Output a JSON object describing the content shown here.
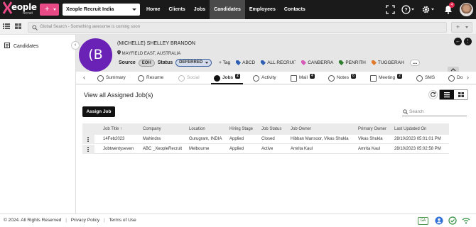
{
  "brand": {
    "name": "eople",
    "sub": "recruit",
    "accent": "#e84a86"
  },
  "topbar": {
    "plus_label": "+",
    "company": "Xeople Recruit India",
    "nav": [
      "Home",
      "Clients",
      "Jobs",
      "Candidates",
      "Employees",
      "Contacts"
    ],
    "active_nav": "Candidates",
    "notification_count": "4",
    "icons": [
      "expand-icon",
      "help-icon",
      "settings-icon",
      "bell-icon",
      "avatar"
    ]
  },
  "subbar": {
    "search_placeholder": "Global Search - Something awesome is coming soon",
    "plus_label": "+"
  },
  "sidebar": {
    "items": [
      {
        "label": "Candidates",
        "icon": "candidate-card-icon"
      }
    ]
  },
  "profile": {
    "avatar_initial": "(B",
    "name": "(MICHELLE) SHELLEY BRANDON",
    "location": "MAYFIELD EAST, AUSTRALIA",
    "source_label": "Source",
    "source_value": "EOH",
    "status_label": "Status",
    "status_value": "DEFERRED",
    "add_tag_label": "+ Tag",
    "tags": [
      "ABCD",
      "ALL RECRUITA",
      "CANBERRA",
      "PENRITH",
      "TUGGERAH"
    ],
    "more_label": "..."
  },
  "tabs": {
    "items": [
      {
        "label": "Summary",
        "badge": ""
      },
      {
        "label": "Resume",
        "badge": ""
      },
      {
        "label": "Social",
        "badge": ""
      },
      {
        "label": "Jobs",
        "badge": "2"
      },
      {
        "label": "Activity",
        "badge": ""
      },
      {
        "label": "Mail",
        "badge": "4"
      },
      {
        "label": "Notes",
        "badge": "6"
      },
      {
        "label": "Meeting",
        "badge": "2"
      },
      {
        "label": "SMS",
        "badge": ""
      },
      {
        "label": "Do",
        "badge": ""
      }
    ],
    "active": "Jobs",
    "disabled": "Social"
  },
  "jobs": {
    "title": "View all Assigned Job(s)",
    "assign_label": "Assign Job",
    "search_placeholder": "Search",
    "columns": [
      "Job Title",
      "Company",
      "Location",
      "Hiring Stage",
      "Job Status",
      "Job Owner",
      "Primary Owner",
      "Last Updated On"
    ],
    "sort_arrow": "↑",
    "rows": [
      [
        "14Feb2023",
        "Mahindra",
        "Gurugram, INDIA",
        "Applied",
        "Closed",
        "Hibban Mansoor, Vikas Shukla",
        "Vikas Shukla",
        "28/10/2023 05:01:01 PM"
      ],
      [
        "Jobtwentyseven",
        "ABC _XeopleRecruit",
        "Melbourne",
        "Applied",
        "Active",
        "Amrita Kaul",
        "Amrita Kaul",
        "28/10/2023 05:02:58 PM"
      ]
    ]
  },
  "footer": {
    "copyright": "© 2024. All Rights Reserved",
    "privacy": "Privacy Policy",
    "terms": "Terms of Use",
    "badge": "GA"
  }
}
